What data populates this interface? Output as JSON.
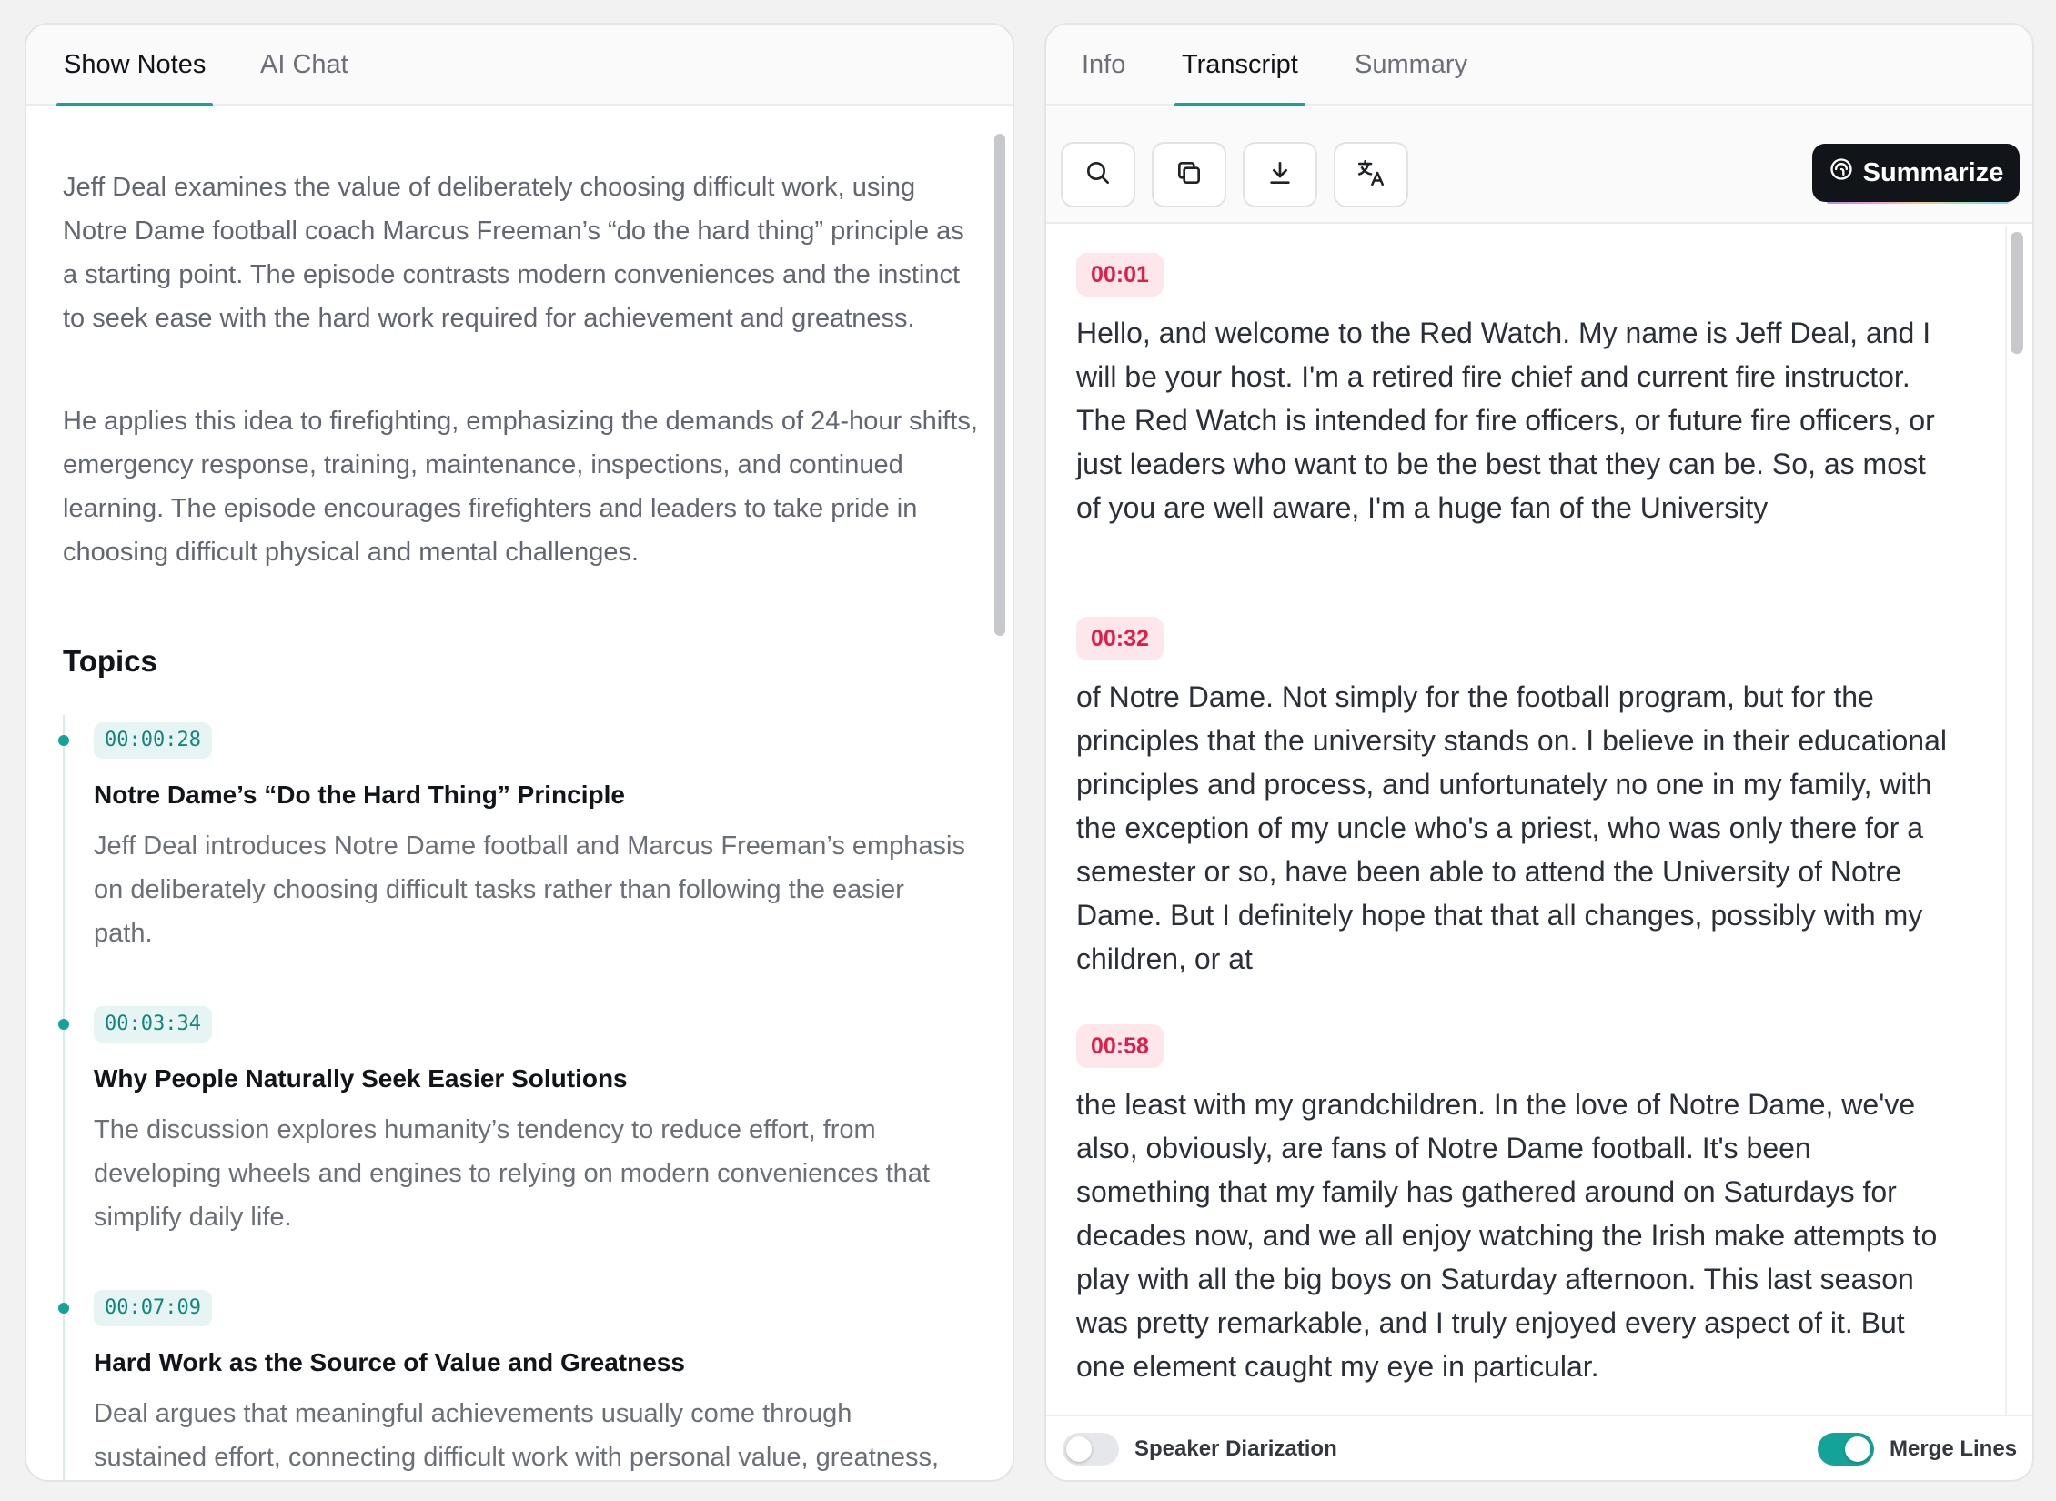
{
  "left_panel": {
    "tabs": [
      {
        "label": "Show Notes",
        "active": true
      },
      {
        "label": "AI Chat",
        "active": false
      }
    ],
    "summary_paragraphs": [
      "Jeff Deal examines the value of deliberately choosing difficult work, using Notre Dame football coach Marcus Freeman’s “do the hard thing” principle as a starting point. The episode contrasts modern conveniences and the instinct to seek ease with the hard work required for achievement and greatness.",
      "He applies this idea to firefighting, emphasizing the demands of 24-hour shifts, emergency response, training, maintenance, inspections, and continued learning. The episode encourages firefighters and leaders to take pride in choosing difficult physical and mental challenges."
    ],
    "topics_heading": "Topics",
    "topics": [
      {
        "timestamp": "00:00:28",
        "title": "Notre Dame’s “Do the Hard Thing” Principle",
        "description": "Jeff Deal introduces Notre Dame football and Marcus Freeman’s emphasis on deliberately choosing difficult tasks rather than following the easier path."
      },
      {
        "timestamp": "00:03:34",
        "title": "Why People Naturally Seek Easier Solutions",
        "description": "The discussion explores humanity’s tendency to reduce effort, from developing wheels and engines to relying on modern conveniences that simplify daily life."
      },
      {
        "timestamp": "00:07:09",
        "title": "Hard Work as the Source of Value and Greatness",
        "description": "Deal argues that meaningful achievements usually come through sustained effort, connecting difficult work with personal value, greatness, and lasting satisfaction."
      }
    ]
  },
  "right_panel": {
    "tabs": [
      {
        "label": "Info",
        "active": false
      },
      {
        "label": "Transcript",
        "active": true
      },
      {
        "label": "Summary",
        "active": false
      }
    ],
    "toolbar": {
      "icons": [
        "search-icon",
        "copy-icon",
        "download-icon",
        "translate-icon"
      ],
      "summarize_label": "Summarize"
    },
    "segments": [
      {
        "timestamp": "00:01",
        "text": "Hello, and welcome to the Red Watch. My name is Jeff Deal, and I will be your host. I'm a retired fire chief and current fire instructor. The Red Watch is intended for fire officers, or future fire officers, or just leaders who want to be the best that they can be. So, as most of you are well aware, I'm a huge fan of the University"
      },
      {
        "timestamp": "00:32",
        "text": "of Notre Dame. Not simply for the football program, but for the principles that the university stands on. I believe in their educational principles and process, and unfortunately no one in my family, with the exception of my uncle who's a priest, who was only there for a semester or so, have been able to attend the University of Notre Dame. But I definitely hope that that all changes, possibly with my children, or at"
      },
      {
        "timestamp": "00:58",
        "text": "the least with my grandchildren. In the love of Notre Dame, we've also, obviously, are fans of Notre Dame football. It's been something that my family has gathered around on Saturdays for decades now, and we all enjoy watching the Irish make attempts to play with all the big boys on Saturday afternoon. This last season was pretty remarkable, and I truly enjoyed every aspect of it. But one element caught my eye in particular."
      }
    ],
    "footer": {
      "speaker_diarization_label": "Speaker Diarization",
      "speaker_diarization_on": false,
      "merge_lines_label": "Merge Lines",
      "merge_lines_on": true
    }
  },
  "colors": {
    "accent": "#14a398",
    "timestamp_red": "#e11d48",
    "timestamp_bg": "#fde7ea"
  }
}
